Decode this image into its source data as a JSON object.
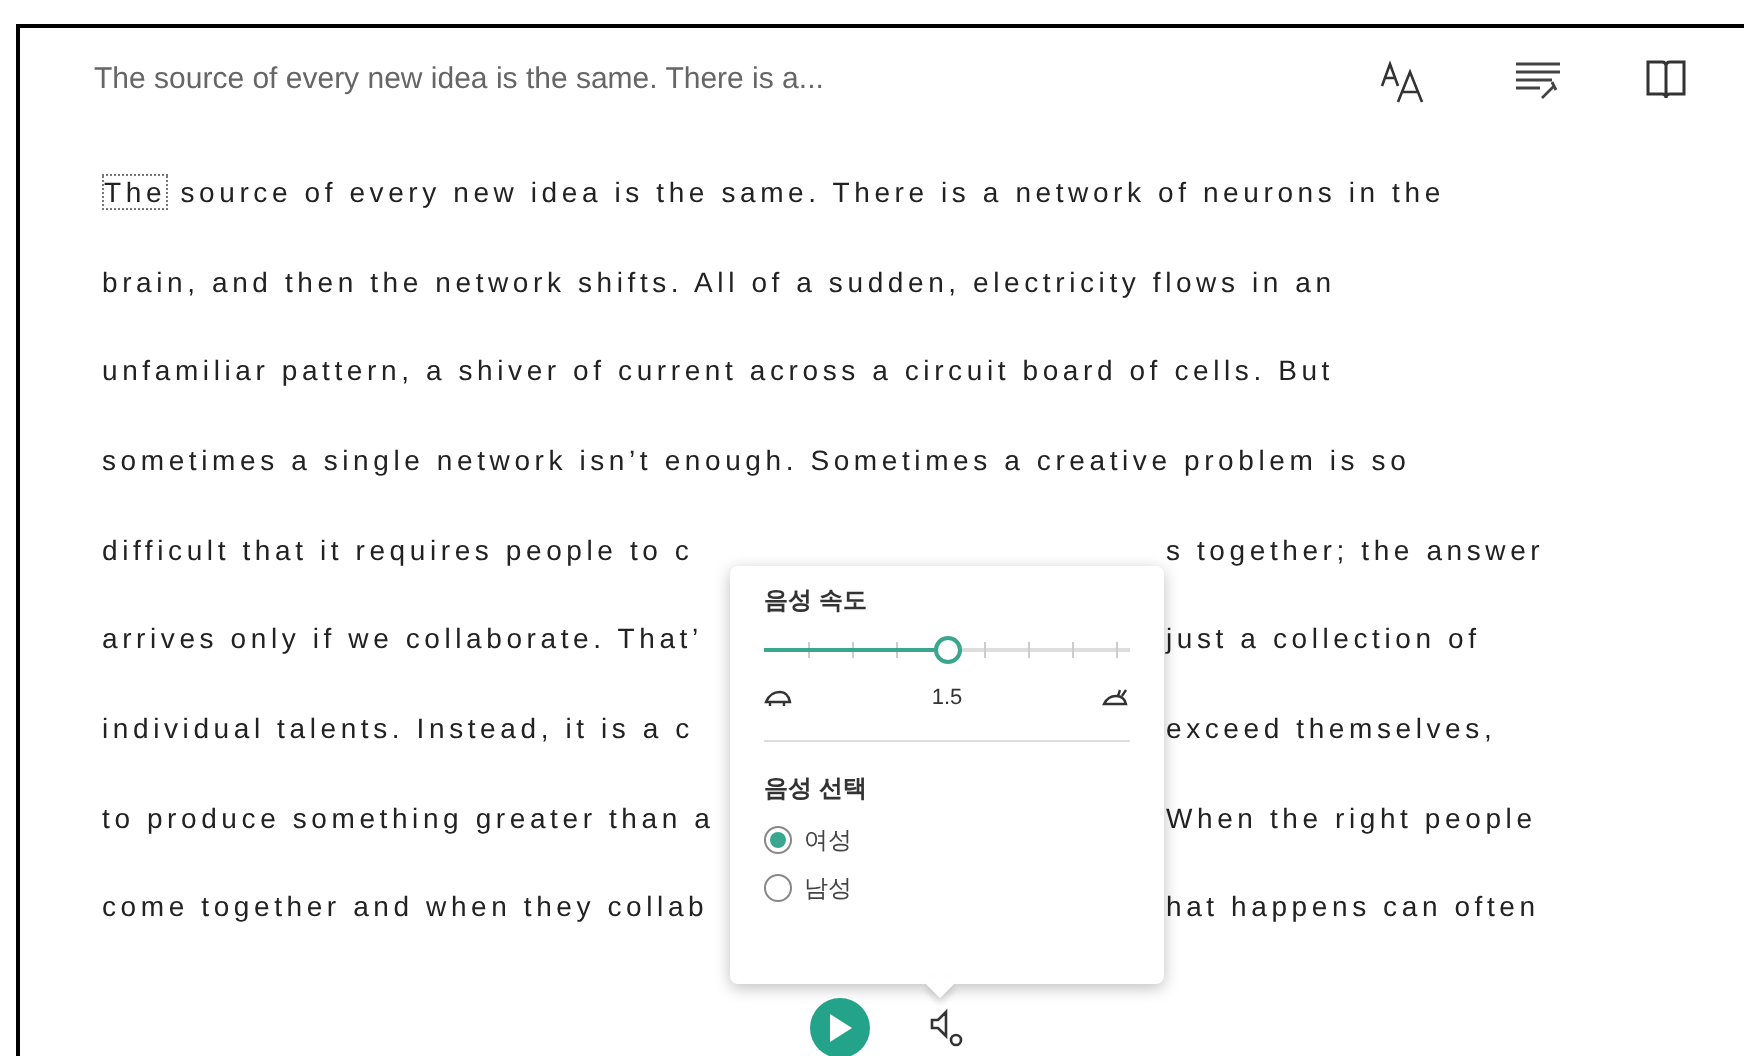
{
  "header": {
    "title": "The source of every new idea is the same. There is a..."
  },
  "lines": [
    {
      "left": "The",
      "rest": " source of every new idea is the same. There is a network of neurons in the",
      "focused": true
    },
    {
      "left": "brain, and then the network shifts. All of a sudden, electricity flows in an"
    },
    {
      "left": "unfamiliar pattern, a shiver of current across a circuit board of cells. But"
    },
    {
      "left": "sometimes a single network isn’t enough. Sometimes a creative problem is so"
    },
    {
      "left": "difficult that it requires people to c",
      "right": "s together; the answer"
    },
    {
      "left": "arrives only if we collaborate. That’",
      "right": "just a collection of"
    },
    {
      "left": "individual talents. Instead, it is a c",
      "right": "exceed themselves,"
    },
    {
      "left": "to produce something greater than a",
      "right": "When the right people"
    },
    {
      "left": "come together and when they collab",
      "right": "hat happens can often"
    }
  ],
  "voice_panel": {
    "speed_title": "음성 속도",
    "speed": {
      "level": 0.5,
      "reading": "1.5"
    },
    "voice_title": "음성 선택",
    "voices": [
      {
        "label": "여성",
        "selected": true
      },
      {
        "label": "남성",
        "selected": false
      }
    ]
  }
}
